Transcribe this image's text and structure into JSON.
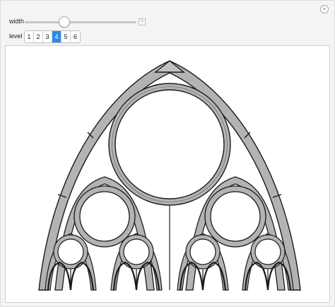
{
  "controls": {
    "width_label": "width",
    "level_label": "level",
    "levels": [
      "1",
      "2",
      "3",
      "4",
      "5",
      "6"
    ],
    "selected_level": "4",
    "width_fraction": 0.35
  },
  "icons": {
    "plus": "plus-icon",
    "slider_plus": "slider-expand-icon"
  },
  "colors": {
    "stone_fill": "#b3b3b3",
    "stroke": "#1a1a1a",
    "selected": "#2e88e8"
  }
}
